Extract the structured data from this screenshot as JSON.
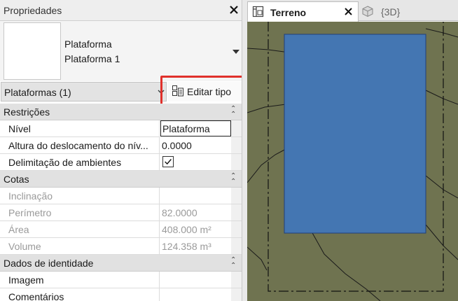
{
  "properties": {
    "title": "Propriedades",
    "type_family": "Plataforma",
    "type_name": "Plataforma 1",
    "instance_selector": "Plataformas (1)",
    "edit_type_label": "Editar tipo",
    "highlight_color": "#e0302b",
    "groups": [
      {
        "label": "Restrições",
        "rows": [
          {
            "name": "Nível",
            "value": "Plataforma"
          },
          {
            "name": "Altura do deslocamento do nív...",
            "value": "0.0000"
          },
          {
            "name": "Delimitação de ambientes",
            "value": "checked"
          }
        ]
      },
      {
        "label": "Cotas",
        "rows": [
          {
            "name": "Inclinação",
            "value": ""
          },
          {
            "name": "Perímetro",
            "value": "82.0000"
          },
          {
            "name": "Área",
            "value": "408.000 m²"
          },
          {
            "name": "Volume",
            "value": "124.358 m³"
          }
        ]
      },
      {
        "label": "Dados de identidade",
        "rows": [
          {
            "name": "Imagem",
            "value": ""
          },
          {
            "name": "Comentários",
            "value": ""
          }
        ]
      }
    ]
  },
  "view_tabs": [
    {
      "label": "Terreno",
      "active": true
    },
    {
      "label": "{3D}",
      "active": false
    }
  ],
  "canvas": {
    "ground_color": "#6f7350",
    "pad_color": "#4476b2",
    "pad_border_color": "#1f3f7a"
  }
}
